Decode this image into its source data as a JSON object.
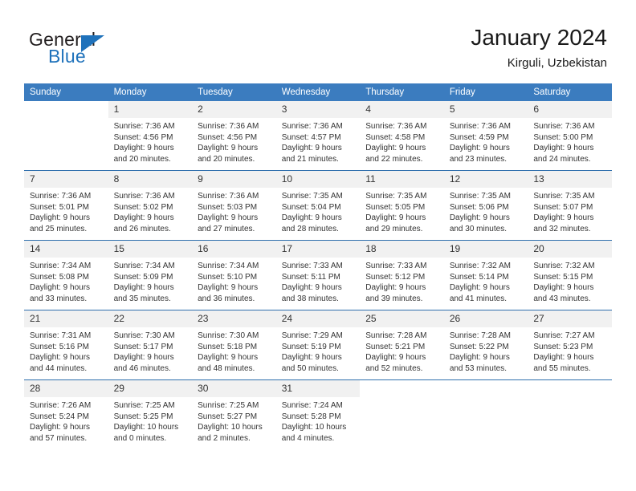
{
  "brand": {
    "name_part1": "General",
    "name_part2": "Blue",
    "flag_icon": "triangle-flag-icon"
  },
  "header": {
    "title": "January 2024",
    "subtitle": "Kirguli, Uzbekistan"
  },
  "colors": {
    "header_blue": "#3b7cbf",
    "brand_blue": "#1f72bb",
    "row_divider": "#2f6fad",
    "daynum_band": "#f1f1f1"
  },
  "calendar": {
    "weekday_headers": [
      "Sunday",
      "Monday",
      "Tuesday",
      "Wednesday",
      "Thursday",
      "Friday",
      "Saturday"
    ],
    "weeks": [
      [
        {
          "day": "",
          "sunrise": "",
          "sunset": "",
          "daylight_line1": "",
          "daylight_line2": ""
        },
        {
          "day": "1",
          "sunrise": "Sunrise: 7:36 AM",
          "sunset": "Sunset: 4:56 PM",
          "daylight_line1": "Daylight: 9 hours",
          "daylight_line2": "and 20 minutes."
        },
        {
          "day": "2",
          "sunrise": "Sunrise: 7:36 AM",
          "sunset": "Sunset: 4:56 PM",
          "daylight_line1": "Daylight: 9 hours",
          "daylight_line2": "and 20 minutes."
        },
        {
          "day": "3",
          "sunrise": "Sunrise: 7:36 AM",
          "sunset": "Sunset: 4:57 PM",
          "daylight_line1": "Daylight: 9 hours",
          "daylight_line2": "and 21 minutes."
        },
        {
          "day": "4",
          "sunrise": "Sunrise: 7:36 AM",
          "sunset": "Sunset: 4:58 PM",
          "daylight_line1": "Daylight: 9 hours",
          "daylight_line2": "and 22 minutes."
        },
        {
          "day": "5",
          "sunrise": "Sunrise: 7:36 AM",
          "sunset": "Sunset: 4:59 PM",
          "daylight_line1": "Daylight: 9 hours",
          "daylight_line2": "and 23 minutes."
        },
        {
          "day": "6",
          "sunrise": "Sunrise: 7:36 AM",
          "sunset": "Sunset: 5:00 PM",
          "daylight_line1": "Daylight: 9 hours",
          "daylight_line2": "and 24 minutes."
        }
      ],
      [
        {
          "day": "7",
          "sunrise": "Sunrise: 7:36 AM",
          "sunset": "Sunset: 5:01 PM",
          "daylight_line1": "Daylight: 9 hours",
          "daylight_line2": "and 25 minutes."
        },
        {
          "day": "8",
          "sunrise": "Sunrise: 7:36 AM",
          "sunset": "Sunset: 5:02 PM",
          "daylight_line1": "Daylight: 9 hours",
          "daylight_line2": "and 26 minutes."
        },
        {
          "day": "9",
          "sunrise": "Sunrise: 7:36 AM",
          "sunset": "Sunset: 5:03 PM",
          "daylight_line1": "Daylight: 9 hours",
          "daylight_line2": "and 27 minutes."
        },
        {
          "day": "10",
          "sunrise": "Sunrise: 7:35 AM",
          "sunset": "Sunset: 5:04 PM",
          "daylight_line1": "Daylight: 9 hours",
          "daylight_line2": "and 28 minutes."
        },
        {
          "day": "11",
          "sunrise": "Sunrise: 7:35 AM",
          "sunset": "Sunset: 5:05 PM",
          "daylight_line1": "Daylight: 9 hours",
          "daylight_line2": "and 29 minutes."
        },
        {
          "day": "12",
          "sunrise": "Sunrise: 7:35 AM",
          "sunset": "Sunset: 5:06 PM",
          "daylight_line1": "Daylight: 9 hours",
          "daylight_line2": "and 30 minutes."
        },
        {
          "day": "13",
          "sunrise": "Sunrise: 7:35 AM",
          "sunset": "Sunset: 5:07 PM",
          "daylight_line1": "Daylight: 9 hours",
          "daylight_line2": "and 32 minutes."
        }
      ],
      [
        {
          "day": "14",
          "sunrise": "Sunrise: 7:34 AM",
          "sunset": "Sunset: 5:08 PM",
          "daylight_line1": "Daylight: 9 hours",
          "daylight_line2": "and 33 minutes."
        },
        {
          "day": "15",
          "sunrise": "Sunrise: 7:34 AM",
          "sunset": "Sunset: 5:09 PM",
          "daylight_line1": "Daylight: 9 hours",
          "daylight_line2": "and 35 minutes."
        },
        {
          "day": "16",
          "sunrise": "Sunrise: 7:34 AM",
          "sunset": "Sunset: 5:10 PM",
          "daylight_line1": "Daylight: 9 hours",
          "daylight_line2": "and 36 minutes."
        },
        {
          "day": "17",
          "sunrise": "Sunrise: 7:33 AM",
          "sunset": "Sunset: 5:11 PM",
          "daylight_line1": "Daylight: 9 hours",
          "daylight_line2": "and 38 minutes."
        },
        {
          "day": "18",
          "sunrise": "Sunrise: 7:33 AM",
          "sunset": "Sunset: 5:12 PM",
          "daylight_line1": "Daylight: 9 hours",
          "daylight_line2": "and 39 minutes."
        },
        {
          "day": "19",
          "sunrise": "Sunrise: 7:32 AM",
          "sunset": "Sunset: 5:14 PM",
          "daylight_line1": "Daylight: 9 hours",
          "daylight_line2": "and 41 minutes."
        },
        {
          "day": "20",
          "sunrise": "Sunrise: 7:32 AM",
          "sunset": "Sunset: 5:15 PM",
          "daylight_line1": "Daylight: 9 hours",
          "daylight_line2": "and 43 minutes."
        }
      ],
      [
        {
          "day": "21",
          "sunrise": "Sunrise: 7:31 AM",
          "sunset": "Sunset: 5:16 PM",
          "daylight_line1": "Daylight: 9 hours",
          "daylight_line2": "and 44 minutes."
        },
        {
          "day": "22",
          "sunrise": "Sunrise: 7:30 AM",
          "sunset": "Sunset: 5:17 PM",
          "daylight_line1": "Daylight: 9 hours",
          "daylight_line2": "and 46 minutes."
        },
        {
          "day": "23",
          "sunrise": "Sunrise: 7:30 AM",
          "sunset": "Sunset: 5:18 PM",
          "daylight_line1": "Daylight: 9 hours",
          "daylight_line2": "and 48 minutes."
        },
        {
          "day": "24",
          "sunrise": "Sunrise: 7:29 AM",
          "sunset": "Sunset: 5:19 PM",
          "daylight_line1": "Daylight: 9 hours",
          "daylight_line2": "and 50 minutes."
        },
        {
          "day": "25",
          "sunrise": "Sunrise: 7:28 AM",
          "sunset": "Sunset: 5:21 PM",
          "daylight_line1": "Daylight: 9 hours",
          "daylight_line2": "and 52 minutes."
        },
        {
          "day": "26",
          "sunrise": "Sunrise: 7:28 AM",
          "sunset": "Sunset: 5:22 PM",
          "daylight_line1": "Daylight: 9 hours",
          "daylight_line2": "and 53 minutes."
        },
        {
          "day": "27",
          "sunrise": "Sunrise: 7:27 AM",
          "sunset": "Sunset: 5:23 PM",
          "daylight_line1": "Daylight: 9 hours",
          "daylight_line2": "and 55 minutes."
        }
      ],
      [
        {
          "day": "28",
          "sunrise": "Sunrise: 7:26 AM",
          "sunset": "Sunset: 5:24 PM",
          "daylight_line1": "Daylight: 9 hours",
          "daylight_line2": "and 57 minutes."
        },
        {
          "day": "29",
          "sunrise": "Sunrise: 7:25 AM",
          "sunset": "Sunset: 5:25 PM",
          "daylight_line1": "Daylight: 10 hours",
          "daylight_line2": "and 0 minutes."
        },
        {
          "day": "30",
          "sunrise": "Sunrise: 7:25 AM",
          "sunset": "Sunset: 5:27 PM",
          "daylight_line1": "Daylight: 10 hours",
          "daylight_line2": "and 2 minutes."
        },
        {
          "day": "31",
          "sunrise": "Sunrise: 7:24 AM",
          "sunset": "Sunset: 5:28 PM",
          "daylight_line1": "Daylight: 10 hours",
          "daylight_line2": "and 4 minutes."
        },
        {
          "day": "",
          "sunrise": "",
          "sunset": "",
          "daylight_line1": "",
          "daylight_line2": ""
        },
        {
          "day": "",
          "sunrise": "",
          "sunset": "",
          "daylight_line1": "",
          "daylight_line2": ""
        },
        {
          "day": "",
          "sunrise": "",
          "sunset": "",
          "daylight_line1": "",
          "daylight_line2": ""
        }
      ]
    ]
  }
}
